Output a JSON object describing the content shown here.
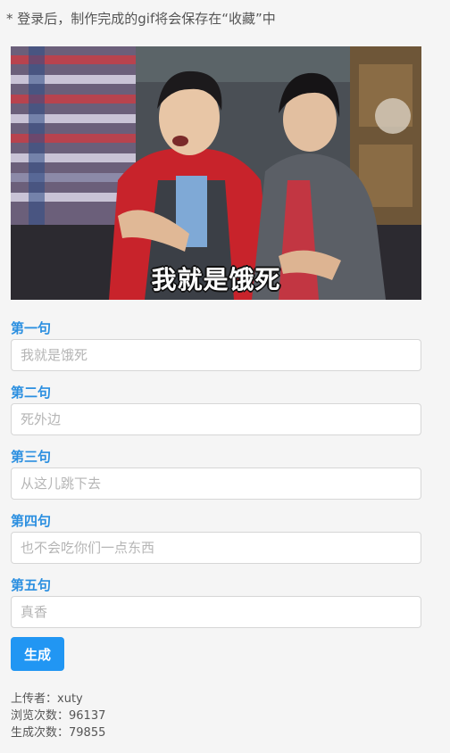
{
  "notice": "* 登录后，制作完成的gif将会保存在“收藏”中",
  "gif": {
    "subtitle": "我就是饿死"
  },
  "fields": [
    {
      "label": "第一句",
      "placeholder": "我就是饿死"
    },
    {
      "label": "第二句",
      "placeholder": "死外边"
    },
    {
      "label": "第三句",
      "placeholder": "从这儿跳下去"
    },
    {
      "label": "第四句",
      "placeholder": "也不会吃你们一点东西"
    },
    {
      "label": "第五句",
      "placeholder": "真香"
    }
  ],
  "generate_button": "生成",
  "stats": {
    "uploader_label": "上传者：",
    "uploader": "xuty",
    "views_label": "浏览次数：",
    "views": "96137",
    "generated_label": "生成次数：",
    "generated": "79855"
  },
  "colors": {
    "accent": "#2196f3",
    "label": "#2b8fe0"
  }
}
